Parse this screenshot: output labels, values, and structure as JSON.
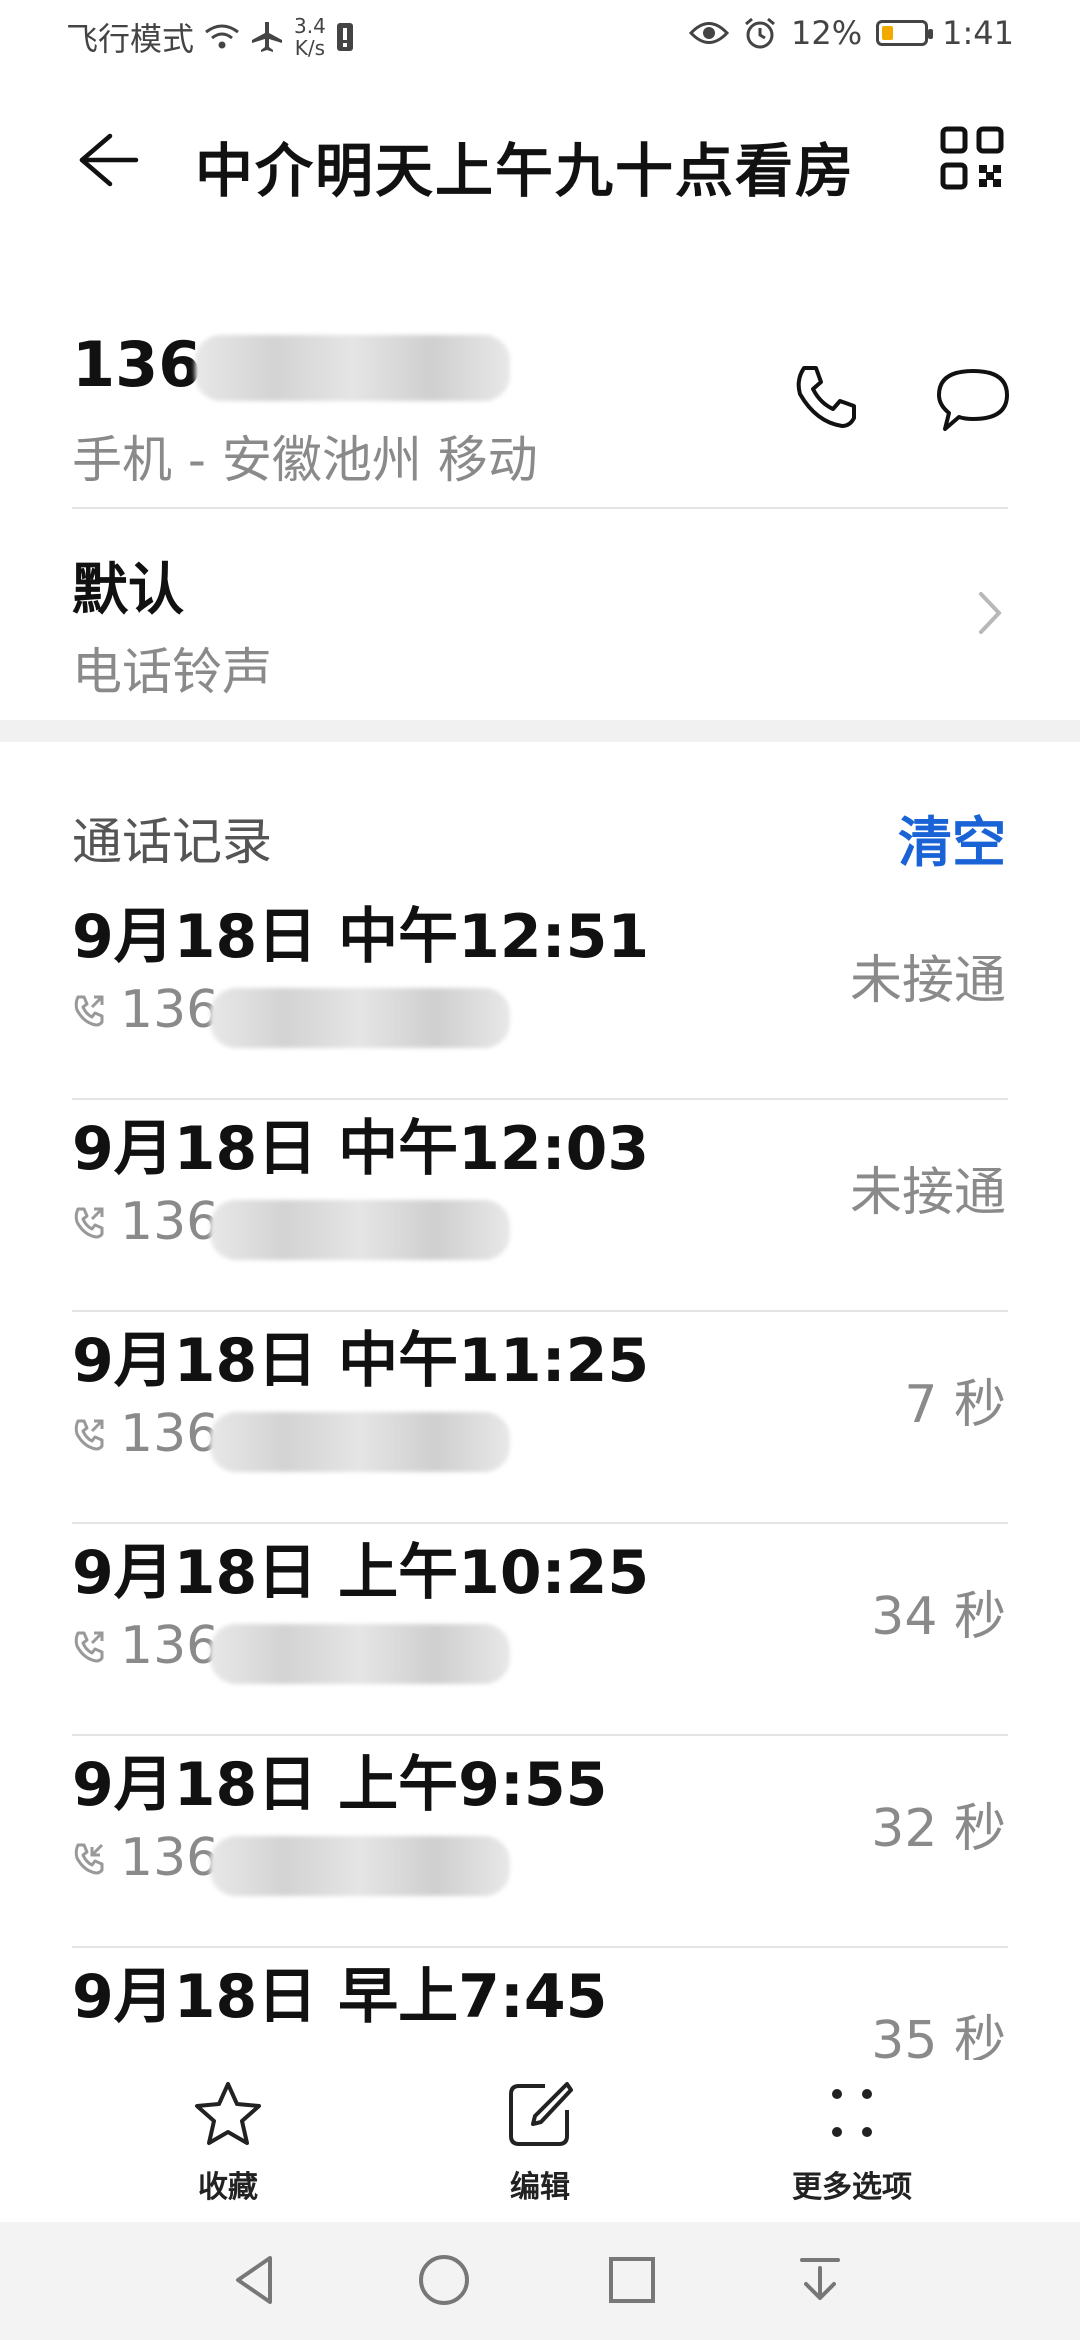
{
  "status_bar": {
    "airplane_label": "飞行模式",
    "speed_value": "3.4",
    "speed_unit": "K/s",
    "battery_text": "12%",
    "battery_level": 0.12,
    "clock": "1:41",
    "icons": [
      "wifi-icon",
      "airplane-icon",
      "notification-icon",
      "eye-icon",
      "alarm-icon",
      "battery-icon"
    ]
  },
  "header": {
    "title": "中介明天上午九十点看房",
    "back_icon": "back-arrow-icon",
    "qr_icon": "qr-code-icon"
  },
  "contact": {
    "number_prefix": "136",
    "sub": "手机 - 安徽池州 移动",
    "ringtone_value": "默认",
    "ringtone_label": "电话铃声"
  },
  "call_log": {
    "title": "通话记录",
    "clear_label": "清空",
    "entries": [
      {
        "time": "9月18日 中午12:51",
        "number": "136",
        "status": "未接通",
        "type": "outgoing"
      },
      {
        "time": "9月18日 中午12:03",
        "number": "136",
        "status": "未接通",
        "type": "outgoing"
      },
      {
        "time": "9月18日 中午11:25",
        "number": "136",
        "status": "7 秒",
        "type": "outgoing"
      },
      {
        "time": "9月18日 上午10:25",
        "number": "136",
        "status": "34 秒",
        "type": "outgoing"
      },
      {
        "time": "9月18日 上午9:55",
        "number": "136",
        "status": "32 秒",
        "type": "incoming"
      },
      {
        "time": "9月18日 早上7:45",
        "number": "",
        "status": "35 秒",
        "type": "outgoing"
      }
    ]
  },
  "bottom_actions": [
    {
      "label": "收藏",
      "icon": "star-icon"
    },
    {
      "label": "编辑",
      "icon": "edit-icon"
    },
    {
      "label": "更多选项",
      "icon": "more-options-icon"
    }
  ],
  "colors": {
    "accent": "#1a63d6",
    "battery_fill": "#f2a900",
    "secondary_text": "#8a8a8a"
  }
}
